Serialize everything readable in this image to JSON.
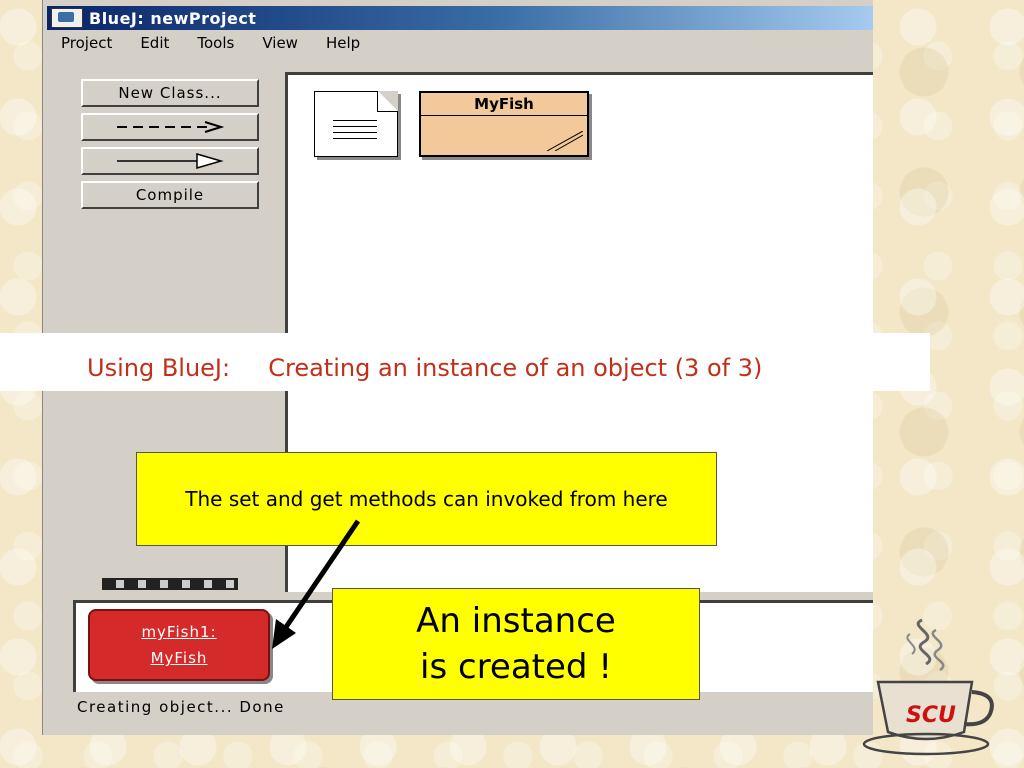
{
  "window": {
    "title": "BlueJ:  newProject",
    "menu": [
      "Project",
      "Edit",
      "Tools",
      "View",
      "Help"
    ]
  },
  "toolbar": {
    "new_class": "New Class...",
    "dep_arrow": "- - - >",
    "inherit_arrow": "——▷",
    "compile": "Compile"
  },
  "diagram": {
    "class_name": "MyFish"
  },
  "object_bench": {
    "instance_line1": "myFish1:",
    "instance_line2": "MyFish"
  },
  "status": "Creating object... Done",
  "slide": {
    "heading": "Using BlueJ:     Creating an instance of an object (3 of 3)",
    "callout_methods": "The set and get methods can invoked from here",
    "callout_instance_line1": "An instance",
    "callout_instance_line2": "is created !",
    "logo_text": "SCU"
  },
  "colors": {
    "heading": "#c0301a",
    "callout": "#ffff00",
    "class_box": "#f4c99a",
    "instance": "#d42a2a"
  }
}
